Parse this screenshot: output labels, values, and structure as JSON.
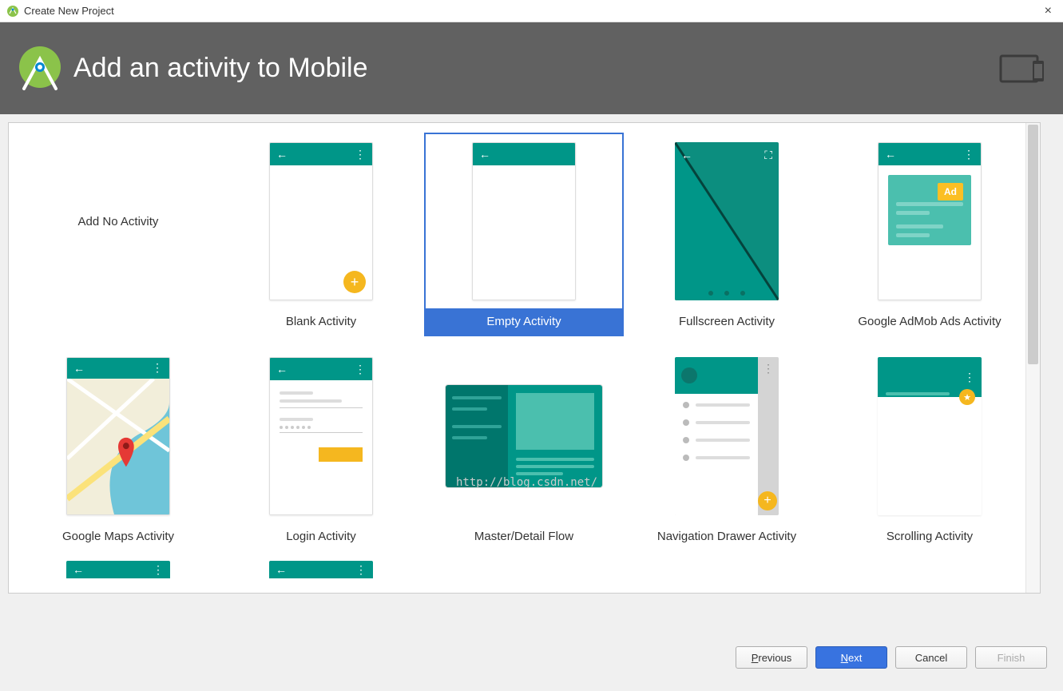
{
  "window": {
    "title": "Create New Project",
    "close_label": "×"
  },
  "header": {
    "title": "Add an activity to Mobile"
  },
  "activities": {
    "add_no_activity": "Add No Activity",
    "blank_activity": "Blank Activity",
    "empty_activity": "Empty Activity",
    "fullscreen_activity": "Fullscreen Activity",
    "admob_activity": "Google AdMob Ads Activity",
    "maps_activity": "Google Maps Activity",
    "login_activity": "Login Activity",
    "master_detail": "Master/Detail Flow",
    "nav_drawer": "Navigation Drawer Activity",
    "scrolling_activity": "Scrolling Activity",
    "ad_badge": "Ad"
  },
  "selected": "empty_activity",
  "watermark": "http://blog.csdn.net/",
  "footer": {
    "previous": "Previous",
    "next": "Next",
    "cancel": "Cancel",
    "finish": "Finish"
  },
  "colors": {
    "teal": "#009688",
    "teal_dark": "#0c766c",
    "accent_blue": "#3973d5",
    "fab_orange": "#f5b71f",
    "header_gray": "#616161"
  }
}
